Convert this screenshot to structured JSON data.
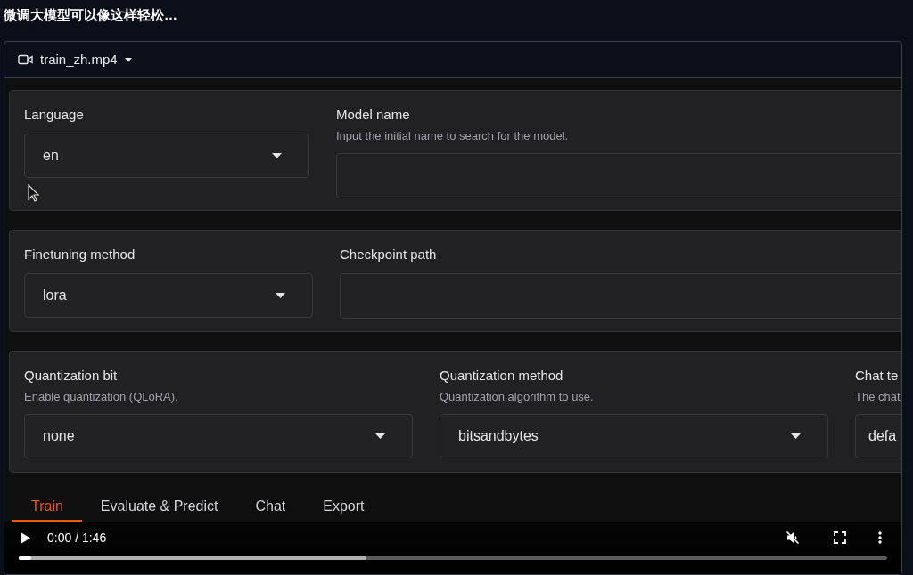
{
  "page_title": "微调大模型可以像这样轻松…",
  "video": {
    "file": "train_zh.mp4",
    "frame": {
      "rows": [
        {
          "fields": [
            {
              "kind": "dropdown",
              "label": "Language",
              "value": "en"
            },
            {
              "kind": "textbox",
              "label": "Model name",
              "info": "Input the initial name to search for the model."
            }
          ]
        },
        {
          "fields": [
            {
              "kind": "dropdown",
              "label": "Finetuning method",
              "value": "lora"
            },
            {
              "kind": "textbox",
              "label": "Checkpoint path"
            }
          ]
        },
        {
          "fields": [
            {
              "kind": "dropdown",
              "label": "Quantization bit",
              "info": "Enable quantization (QLoRA).",
              "value": "none"
            },
            {
              "kind": "dropdown",
              "label": "Quantization method",
              "info": "Quantization algorithm to use.",
              "value": "bitsandbytes"
            },
            {
              "kind": "cut",
              "label": "Chat te",
              "info": "The chat",
              "value": "defa"
            }
          ]
        }
      ],
      "tabs": [
        {
          "label": "Train",
          "selected": true
        },
        {
          "label": "Evaluate & Predict",
          "selected": false
        },
        {
          "label": "Chat",
          "selected": false
        },
        {
          "label": "Export",
          "selected": false
        }
      ]
    },
    "controls": {
      "time": "0:00 / 1:46",
      "progress": {
        "level": 0.014
      },
      "buffer": {
        "level": 0.4
      },
      "muted": true
    }
  }
}
